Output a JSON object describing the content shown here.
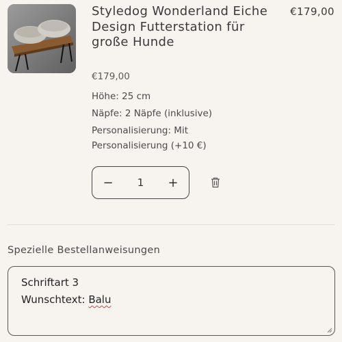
{
  "item": {
    "title": "Styledog Wonderland Eiche Design Futterstation für große Hunde",
    "line_total": "€179,00",
    "unit_price": "€179,00",
    "options": [
      "Höhe: 25 cm",
      "Näpfe: 2 Näpfe (inklusive)",
      "Personalisierung: Mit Personalisierung (+10 €)"
    ],
    "quantity": {
      "minus": "−",
      "value": "1",
      "plus": "+"
    }
  },
  "note": {
    "label": "Spezielle Bestellanweisungen",
    "line1": "Schriftart 3",
    "line2_prefix": "Wunschtext: ",
    "line2_word": "Balu"
  },
  "icons": {
    "remove": "trash-icon",
    "resize": "resize-grip-icon"
  },
  "colors": {
    "background": "#f7f3ef",
    "text": "#3a3a3a",
    "spellcheck": "#d94040"
  }
}
